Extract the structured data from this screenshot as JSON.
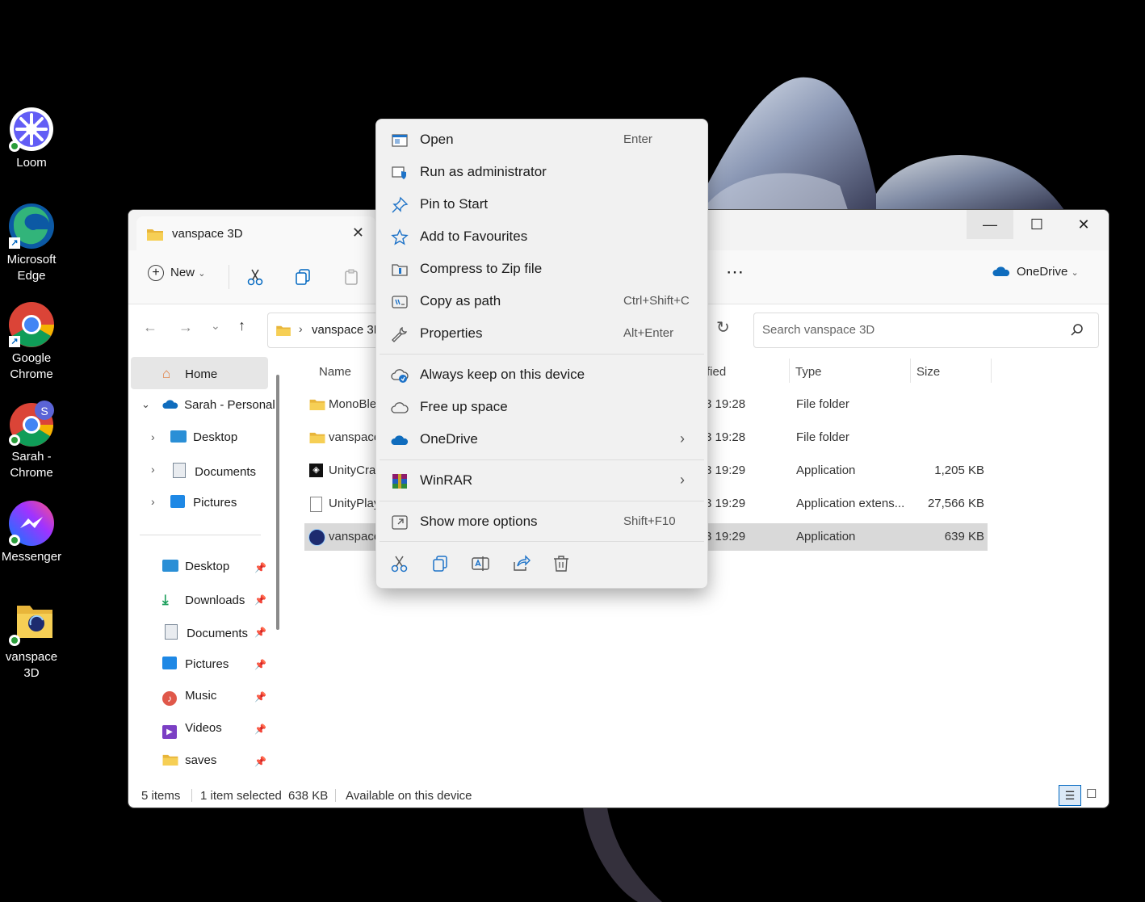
{
  "desktop": {
    "icons": [
      {
        "label": "Loom"
      },
      {
        "label": "Microsoft Edge"
      },
      {
        "label": "Google Chrome"
      },
      {
        "label": "Sarah - Chrome",
        "avatar": "S"
      },
      {
        "label": "Messenger"
      },
      {
        "label": "vanspace 3D"
      }
    ]
  },
  "explorer": {
    "tab_title": "vanspace 3D",
    "toolbar": {
      "new_label": "New",
      "onedrive_label": "OneDrive"
    },
    "address": {
      "folder": "vanspace 3D"
    },
    "search": {
      "placeholder": "Search vanspace 3D"
    },
    "nav": {
      "home": "Home",
      "onedrive": "Sarah - Personal",
      "od_children": [
        "Desktop",
        "Documents",
        "Pictures"
      ],
      "quick": [
        "Desktop",
        "Downloads",
        "Documents",
        "Pictures",
        "Music",
        "Videos",
        "saves"
      ]
    },
    "columns": {
      "name": "Name",
      "modified": "fied",
      "type": "Type",
      "size": "Size"
    },
    "rows": [
      {
        "name": "MonoBle",
        "modified": "3 19:28",
        "type": "File folder",
        "size": ""
      },
      {
        "name": "vanspace",
        "modified": "3 19:28",
        "type": "File folder",
        "size": ""
      },
      {
        "name": "UnityCras",
        "modified": "3 19:29",
        "type": "Application",
        "size": "1,205 KB"
      },
      {
        "name": "UnityPlay",
        "modified": "3 19:29",
        "type": "Application extens...",
        "size": "27,566 KB"
      },
      {
        "name": "vanspace",
        "modified": "3 19:29",
        "type": "Application",
        "size": "639 KB"
      }
    ],
    "status": {
      "items": "5 items",
      "selected": "1 item selected",
      "size": "638 KB",
      "availability": "Available on this device"
    }
  },
  "context_menu": {
    "items": [
      {
        "label": "Open",
        "shortcut": "Enter",
        "icon": "open-icon"
      },
      {
        "label": "Run as administrator",
        "shortcut": "",
        "icon": "shield-icon"
      },
      {
        "label": "Pin to Start",
        "shortcut": "",
        "icon": "pin-icon"
      },
      {
        "label": "Add to Favourites",
        "shortcut": "",
        "icon": "star-icon"
      },
      {
        "label": "Compress to Zip file",
        "shortcut": "",
        "icon": "zip-icon"
      },
      {
        "label": "Copy as path",
        "shortcut": "Ctrl+Shift+C",
        "icon": "path-icon"
      },
      {
        "label": "Properties",
        "shortcut": "Alt+Enter",
        "icon": "wrench-icon"
      },
      {
        "label": "Always keep on this device",
        "shortcut": "",
        "icon": "cloud-sync-icon"
      },
      {
        "label": "Free up space",
        "shortcut": "",
        "icon": "cloud-outline-icon"
      },
      {
        "label": "OneDrive",
        "shortcut": "",
        "icon": "onedrive-icon"
      },
      {
        "label": "WinRAR",
        "shortcut": "",
        "icon": "winrar-icon"
      },
      {
        "label": "Show more options",
        "shortcut": "Shift+F10",
        "icon": "more-options-icon"
      }
    ]
  },
  "colors": {
    "accent": "#0067c0",
    "menu_bg": "#f1f1f1",
    "selection": "#d9d9d9"
  }
}
